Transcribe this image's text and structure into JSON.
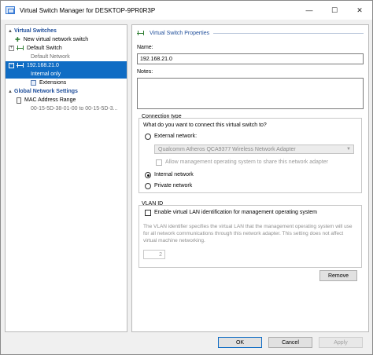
{
  "window": {
    "title": "Virtual Switch Manager for DESKTOP-9PR0R3P",
    "minimize_icon": "minimize-icon",
    "maximize_icon": "maximize-icon",
    "close_icon": "close-icon",
    "minimize_glyph": "—",
    "maximize_glyph": "☐",
    "close_glyph": "✕"
  },
  "tree": {
    "virtual_switches": "Virtual Switches",
    "new_switch": "New virtual network switch",
    "default_switch": {
      "label": "Default Switch",
      "sub": "Default Network",
      "expand": "+"
    },
    "selected_switch": {
      "label": "192.168.21.0",
      "sub": "Internal only",
      "expand": "−"
    },
    "extensions": "Extensions",
    "global_settings": "Global Network Settings",
    "mac_range": {
      "label": "MAC Address Range",
      "sub": "00-15-5D-38-01-00 to 00-15-5D-3..."
    },
    "caret": "▲"
  },
  "props": {
    "header": "Virtual Switch Properties",
    "name_label": "Name:",
    "name_value": "192.168.21.0",
    "notes_label": "Notes:",
    "notes_value": "",
    "connection_type": {
      "title": "Connection type",
      "question": "What do you want to connect this virtual switch to?",
      "external": "External network:",
      "adapter": "Qualcomm Atheros QCA9377 Wireless Network Adapter",
      "allow_mgmt": "Allow management operating system to share this network adapter",
      "internal": "Internal network",
      "private": "Private network",
      "selected": "internal"
    },
    "vlan": {
      "title": "VLAN ID",
      "enable": "Enable virtual LAN identification for management operating system",
      "description": "The VLAN identifier specifies the virtual LAN that the management operating system will use for all network communications through this network adapter. This setting does not affect virtual machine networking.",
      "value": "2"
    },
    "remove": "Remove"
  },
  "footer": {
    "ok": "OK",
    "cancel": "Cancel",
    "apply": "Apply"
  },
  "colors": {
    "selection": "#0f6cc4",
    "section_heading": "#1f4e9a"
  }
}
